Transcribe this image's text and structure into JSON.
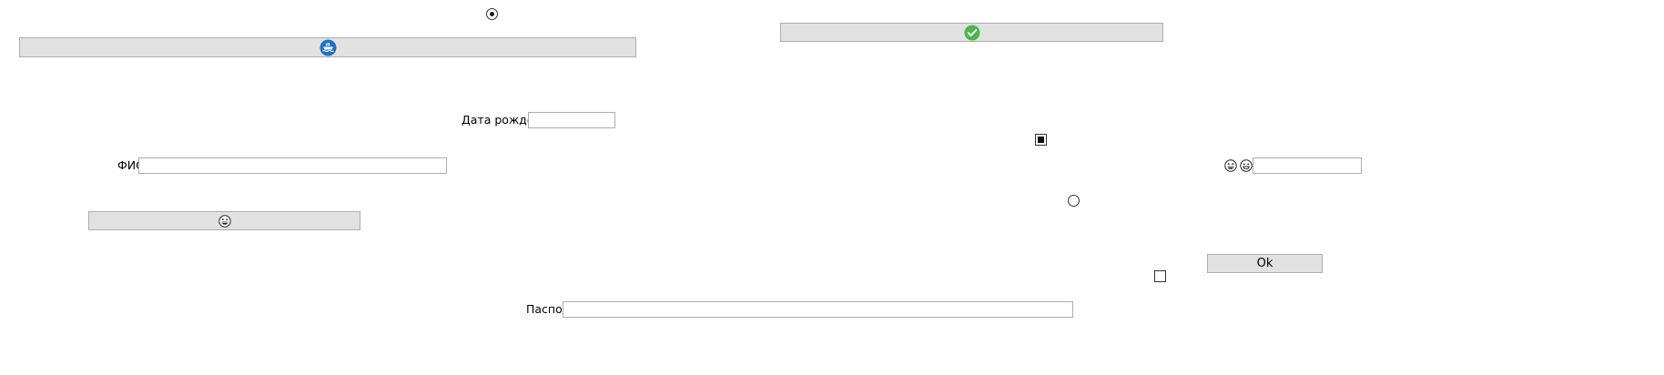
{
  "form": {
    "fio_label": "ФИО",
    "fio_value": "",
    "birth_label": "Дата рождения",
    "birth_value": "",
    "passport_label": "Паспорт",
    "passport_value": "",
    "emoji_field_value": "",
    "ok_label": "Ok"
  },
  "controls": {
    "radio_top_checked": true,
    "radio_right_checked": false,
    "check_filled_checked": true,
    "check_empty_checked": false
  },
  "icons": {
    "ship_button_icon": "ship-icon",
    "check_button_icon": "checkmark-icon",
    "emoji_button_icon": "grinning-face-icon",
    "emoji_pair": [
      "grinning-face-icon",
      "smiling-face-icon"
    ]
  },
  "colors": {
    "button_bg": "#e1e1e1",
    "button_border": "#adadad",
    "field_border": "#abadb3",
    "ship_blue": "#1a73c9",
    "check_green": "#4cb648"
  }
}
